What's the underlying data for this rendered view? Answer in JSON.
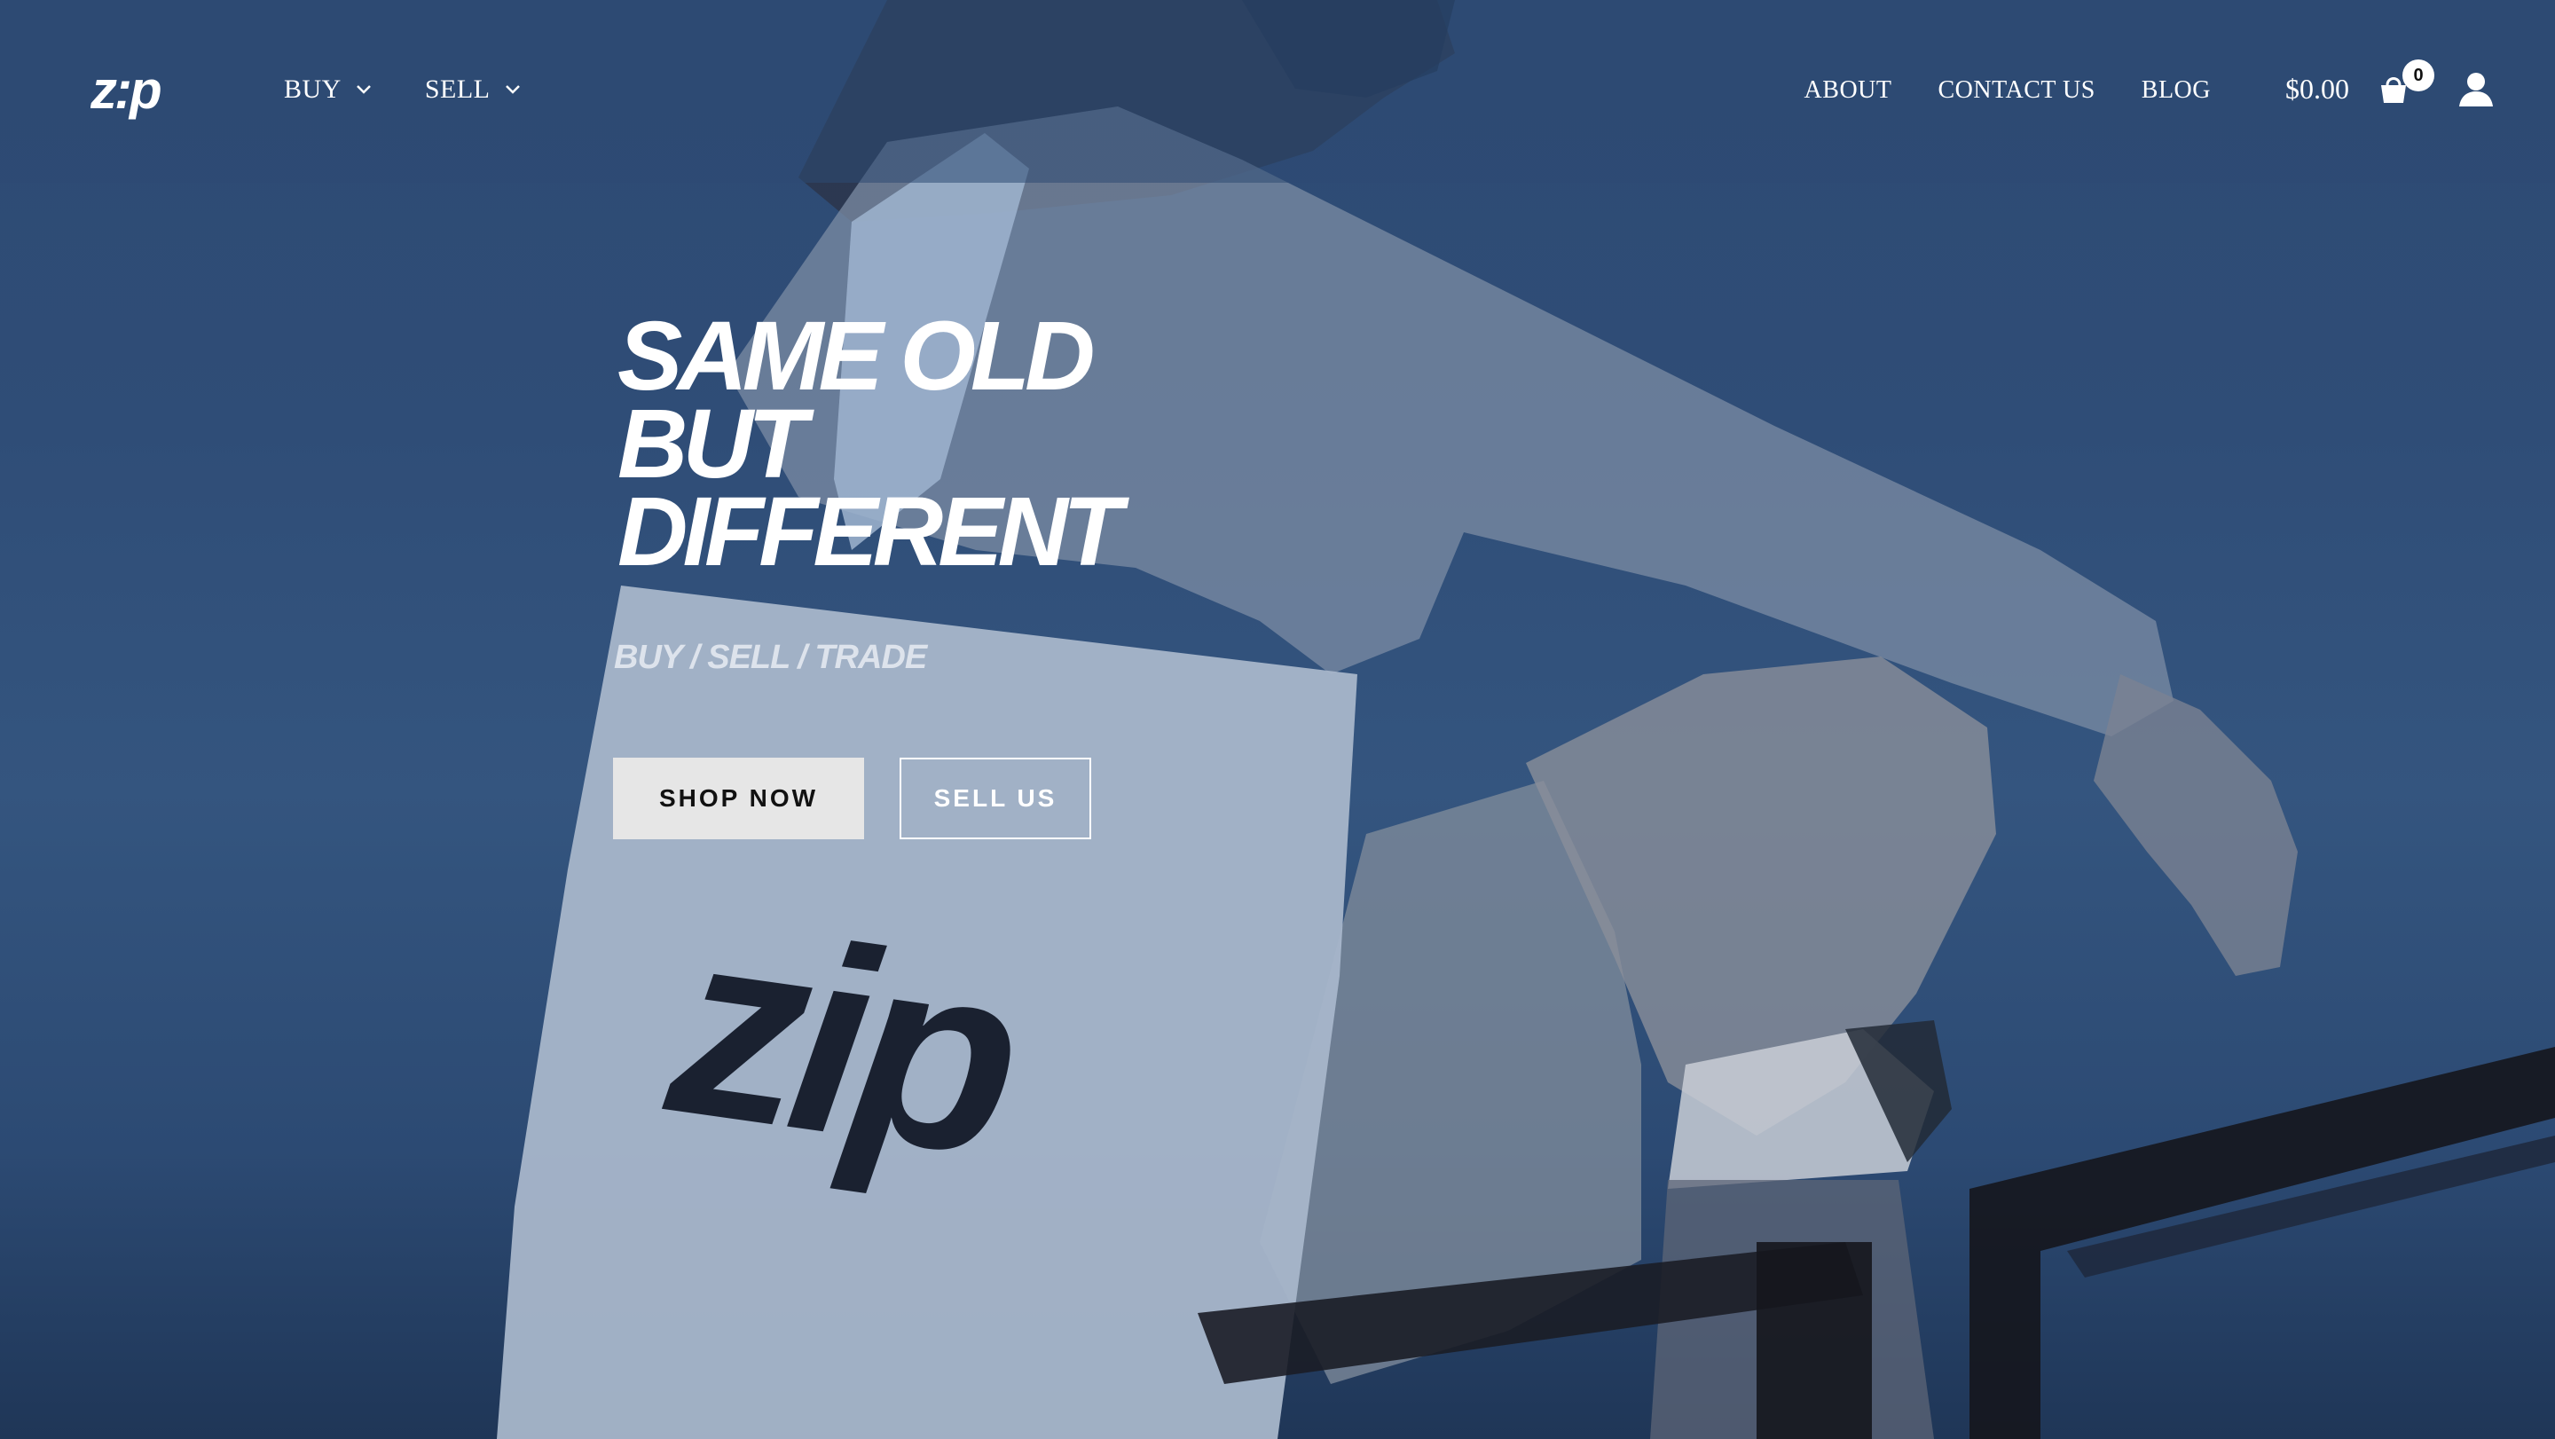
{
  "brand": {
    "logo_text": "z:p"
  },
  "nav": {
    "left": [
      {
        "label": "BUY"
      },
      {
        "label": "SELL"
      }
    ],
    "right": [
      {
        "label": "ABOUT"
      },
      {
        "label": "CONTACT US"
      },
      {
        "label": "BLOG"
      }
    ]
  },
  "cart": {
    "total": "$0.00",
    "count": "0",
    "icon": "shopping-bag-icon"
  },
  "account": {
    "icon": "user-icon"
  },
  "hero": {
    "title_lines": [
      "SAME OLD",
      "BUT",
      "DIFFERENT"
    ],
    "subtitle": "BUY / SELL / TRADE",
    "primary_button": "SHOP NOW",
    "secondary_button": "SELL US",
    "bag_logo_text": "zip"
  },
  "colors": {
    "overlay": "#2d4a72",
    "text": "#ffffff",
    "primary_button_bg": "#e6e6e6",
    "primary_button_text": "#111111"
  }
}
